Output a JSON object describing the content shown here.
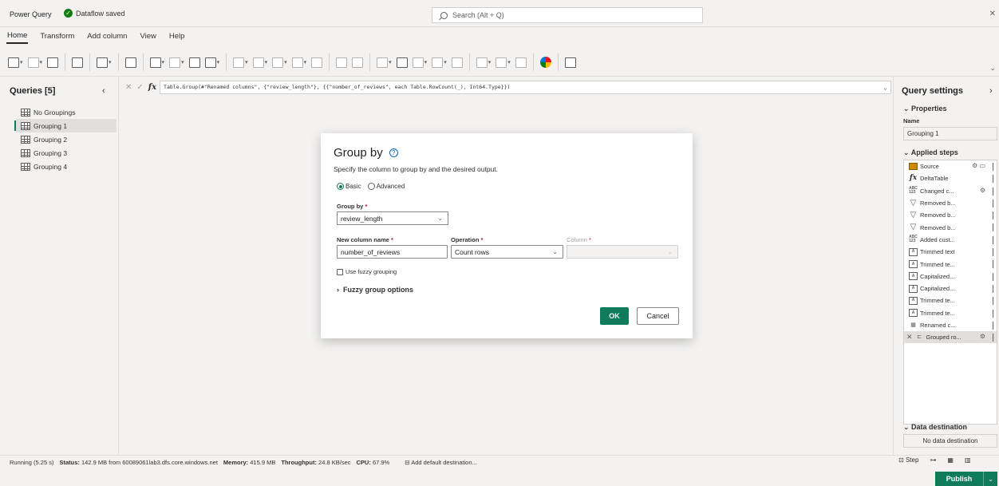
{
  "app": {
    "title": "Power Query",
    "saved_status": "Dataflow saved",
    "search_placeholder": "Search (Alt + Q)"
  },
  "menu": [
    "Home",
    "Transform",
    "Add column",
    "View",
    "Help"
  ],
  "queries": {
    "title": "Queries [5]",
    "items": [
      "No Groupings",
      "Grouping 1",
      "Grouping 2",
      "Grouping 3",
      "Grouping 4"
    ],
    "selected": "Grouping 1"
  },
  "formula": {
    "text": "Table.Group(#\"Renamed columns\", {\"review_length\"}, {{\"number_of_reviews\", each Table.RowCount(_), Int64.Type}})"
  },
  "settings": {
    "title": "Query settings",
    "properties_label": "Properties",
    "name_label": "Name",
    "name_value": "Grouping 1",
    "applied_steps_label": "Applied steps",
    "steps": [
      {
        "label": "Source",
        "icon": "source-table-icon"
      },
      {
        "label": "DeltaTable",
        "icon": "fx-icon"
      },
      {
        "label": "Changed c...",
        "icon": "abc-123-icon"
      },
      {
        "label": "Removed b...",
        "icon": "filter-icon"
      },
      {
        "label": "Removed b...",
        "icon": "filter-icon"
      },
      {
        "label": "Removed b...",
        "icon": "filter-icon"
      },
      {
        "label": "Added cust...",
        "icon": "abc-123-icon"
      },
      {
        "label": "Trimmed text",
        "icon": "text-transform-icon"
      },
      {
        "label": "Trimmed te...",
        "icon": "text-transform-icon"
      },
      {
        "label": "Capitalized...",
        "icon": "text-transform-icon"
      },
      {
        "label": "Capitalized...",
        "icon": "text-transform-icon"
      },
      {
        "label": "Trimmed te...",
        "icon": "text-transform-icon"
      },
      {
        "label": "Trimmed te...",
        "icon": "text-transform-icon"
      },
      {
        "label": "Renamed c...",
        "icon": "rename-columns-icon"
      },
      {
        "label": "Grouped ro...",
        "icon": "group-by-icon"
      }
    ],
    "data_destination_label": "Data destination",
    "data_destination_value": "No data destination"
  },
  "status": {
    "running": "Running (5.25 s)",
    "status_label": "Status:",
    "status_value": "142.9 MB from 60089061lab3.dfs.core.windows.net",
    "memory_label": "Memory:",
    "memory_value": "415.9 MB",
    "throughput_label": "Throughput:",
    "throughput_value": "24.8 KB/sec",
    "cpu_label": "CPU:",
    "cpu_value": "67.9%",
    "add_destination": "Add default destination...",
    "step_label": "Step"
  },
  "publish_label": "Publish",
  "dialog": {
    "title": "Group by",
    "subtitle": "Specify the column to group by and the desired output.",
    "radio_basic": "Basic",
    "radio_advanced": "Advanced",
    "group_by_label": "Group by",
    "group_by_value": "review_length",
    "new_column_label": "New column name",
    "new_column_value": "number_of_reviews",
    "operation_label": "Operation",
    "operation_value": "Count rows",
    "column_label": "Column",
    "required_mark": "*",
    "fuzzy_checkbox": "Use fuzzy grouping",
    "fuzzy_options": "Fuzzy group options",
    "ok_label": "OK",
    "cancel_label": "Cancel"
  },
  "colors": {
    "accent": "#0f7b5a",
    "saved_green": "#107c10"
  }
}
